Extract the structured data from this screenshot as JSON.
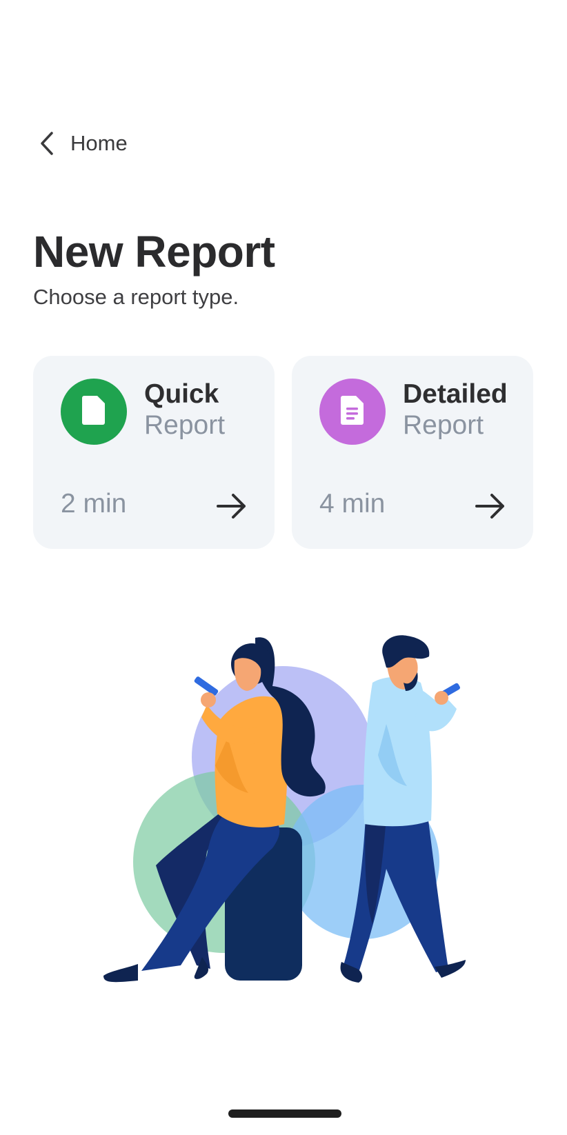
{
  "nav": {
    "back_label": "Home",
    "back_icon": "chevron-left-icon"
  },
  "header": {
    "title": "New Report",
    "subtitle": "Choose a report type."
  },
  "cards": [
    {
      "title_bold": "Quick",
      "title_light": "Report",
      "duration": "2 min",
      "icon": "document-icon",
      "badge_color": "#1fa34f"
    },
    {
      "title_bold": "Detailed",
      "title_light": "Report",
      "duration": "4 min",
      "icon": "document-lines-icon",
      "badge_color": "#c46bdc"
    }
  ],
  "colors": {
    "card_bg": "#f2f5f8",
    "muted_text": "#8a93a0",
    "primary_text": "#2b2b2d"
  },
  "illustration": {
    "subject": "two-people-using-phones"
  }
}
